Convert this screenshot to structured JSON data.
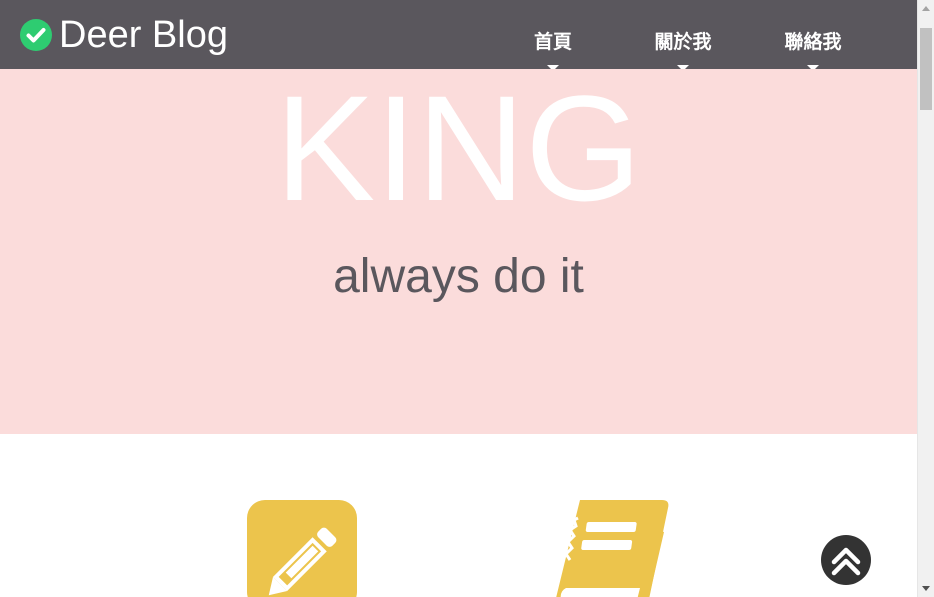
{
  "header": {
    "logo_text": "Deer Blog",
    "nav": [
      {
        "label": "首頁"
      },
      {
        "label": "關於我"
      },
      {
        "label": "聯絡我"
      }
    ]
  },
  "hero": {
    "title": "KING",
    "subtitle": "always do it"
  },
  "features": {
    "icons": [
      "pencil-square-icon",
      "book-icon"
    ]
  },
  "back_to_top": {
    "icon": "double-chevron-up-icon"
  },
  "colors": {
    "header_bg": "#5a575d",
    "hero_bg": "#fbdcdb",
    "hero_title": "#ffffff",
    "hero_subtitle": "#5a575d",
    "accent": "#ecc44c",
    "logo_check": "#2ecc71",
    "back_to_top_bg": "#333333"
  }
}
